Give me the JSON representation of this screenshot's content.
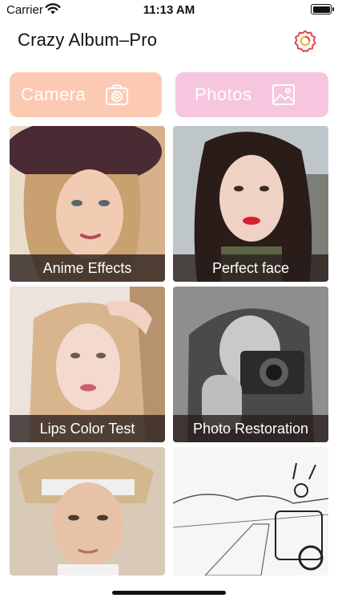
{
  "status_bar": {
    "carrier": "Carrier",
    "time": "11:13 AM",
    "icons": [
      "wifi-icon",
      "battery-icon"
    ]
  },
  "header": {
    "title": "Crazy Album–Pro",
    "settings_icon": "gear-icon",
    "accent_color": "#e0484f"
  },
  "actions": {
    "camera_label": "Camera",
    "camera_icon": "camera-icon",
    "camera_color": "#fccab3",
    "photos_label": "Photos",
    "photos_icon": "image-icon",
    "photos_color": "#f5c6de"
  },
  "features": [
    {
      "label": "Anime Effects"
    },
    {
      "label": "Perfect face"
    },
    {
      "label": "Lips Color Test"
    },
    {
      "label": "Photo Restoration"
    },
    {
      "label": ""
    },
    {
      "label": ""
    }
  ]
}
